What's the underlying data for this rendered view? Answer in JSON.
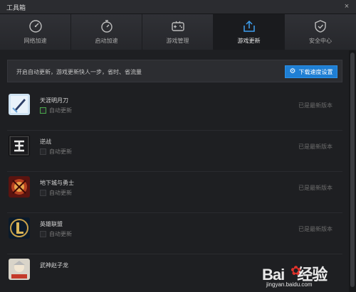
{
  "window": {
    "title": "工具箱",
    "close_symbol": "×"
  },
  "tabs": [
    {
      "label": "网络加速",
      "icon": "speedometer-icon",
      "active": false
    },
    {
      "label": "启动加速",
      "icon": "stopwatch-icon",
      "active": false
    },
    {
      "label": "游戏管理",
      "icon": "gamepad-icon",
      "active": false
    },
    {
      "label": "游戏更新",
      "icon": "upload-icon",
      "active": true
    },
    {
      "label": "安全中心",
      "icon": "shield-check-icon",
      "active": false
    }
  ],
  "notice": {
    "text": "开启自动更新，游戏更新快人一步，省时、省流量",
    "button_label": "下载速度设置",
    "button_icon": "gear-icon"
  },
  "games": [
    {
      "name": "天涯明月刀",
      "auto_update_label": "自动更新",
      "auto_update_checked": true,
      "status": "已是最新版本"
    },
    {
      "name": "逆战",
      "auto_update_label": "自动更新",
      "auto_update_checked": false,
      "status": "已是最新版本"
    },
    {
      "name": "地下城与勇士",
      "auto_update_label": "自动更新",
      "auto_update_checked": false,
      "status": "已是最新版本"
    },
    {
      "name": "英雄联盟",
      "auto_update_label": "自动更新",
      "auto_update_checked": false,
      "status": "已是最新版本"
    },
    {
      "name": "武神赵子龙"
    }
  ],
  "watermark": {
    "brand": "Bai",
    "brand2": "经验",
    "url": "jingyan.baidu.com"
  },
  "colors": {
    "accent": "#1f7fd4",
    "checkbox_checked": "#4aa84a",
    "background": "#1e1f22"
  }
}
